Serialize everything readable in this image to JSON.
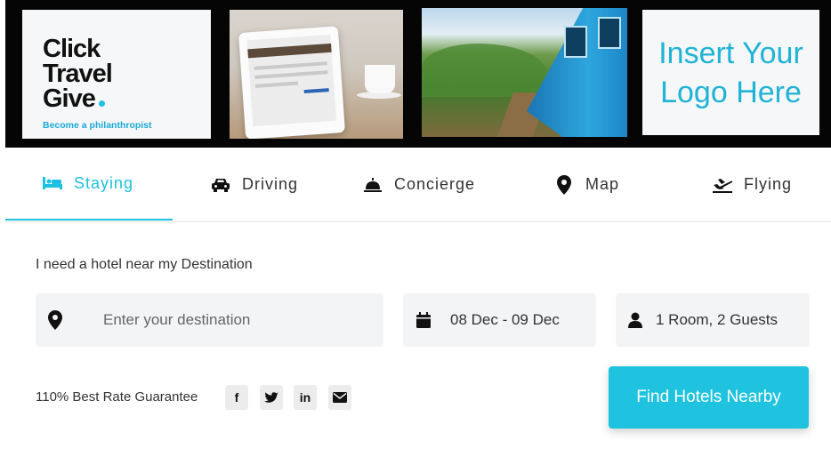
{
  "banner": {
    "logo": {
      "line1": "Click",
      "line2": "Travel",
      "line3": "Give",
      "tagline": "Become a philanthropist"
    },
    "placeholder_line1": "Insert Your",
    "placeholder_line2": "Logo Here"
  },
  "tabs": [
    {
      "label": "Staying",
      "icon": "bed-icon",
      "active": true
    },
    {
      "label": "Driving",
      "icon": "car-icon",
      "active": false
    },
    {
      "label": "Concierge",
      "icon": "bell-icon",
      "active": false
    },
    {
      "label": "Map",
      "icon": "map-pin-icon",
      "active": false
    },
    {
      "label": "Flying",
      "icon": "plane-icon",
      "active": false
    }
  ],
  "form": {
    "label": "I need a hotel near my Destination",
    "destination_placeholder": "Enter your destination",
    "destination_value": "",
    "dates": "08 Dec - 09 Dec",
    "guests": "1 Room, 2 Guests",
    "guarantee": "110% Best Rate Guarantee",
    "submit_label": "Find Hotels Nearby"
  },
  "social": [
    {
      "icon": "facebook-icon",
      "glyph": "f"
    },
    {
      "icon": "twitter-icon",
      "glyph": ""
    },
    {
      "icon": "linkedin-icon",
      "glyph": "in"
    },
    {
      "icon": "email-icon",
      "glyph": ""
    }
  ],
  "colors": {
    "accent": "#1fc3e0",
    "banner_bg": "#050505",
    "field_bg": "#f3f4f6",
    "text": "#333333"
  }
}
